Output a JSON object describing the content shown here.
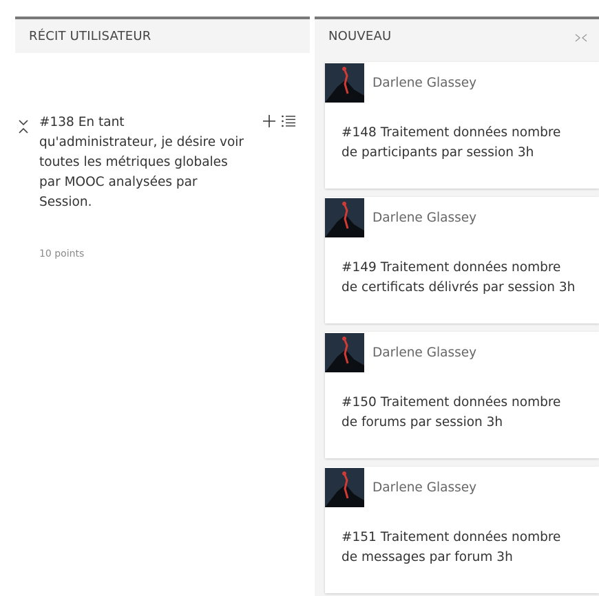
{
  "story_column": {
    "header": "RÉCIT UTILISATEUR",
    "story": {
      "title": "#138 En tant qu'administrateur, je désire voir toutes les métriques globales par MOOC analysées par Session.",
      "points": "10 points",
      "icons": {
        "collapse": "chevron-collapse-icon",
        "add": "plus-icon",
        "list": "list-icon"
      }
    }
  },
  "state_column": {
    "header": "NOUVEAU",
    "collapse_icon": "collapse-column-icon",
    "cards": [
      {
        "assignee": "Darlene Glassey",
        "title": "#148 Traitement données nombre de participants par session 3h"
      },
      {
        "assignee": "Darlene Glassey",
        "title": "#149 Traitement données nombre de certificats délivrés par session 3h"
      },
      {
        "assignee": "Darlene Glassey",
        "title": "#150 Traitement données nombre de forums par session 3h"
      },
      {
        "assignee": "Darlene Glassey",
        "title": "#151 Traitement données nombre de messages par forum 3h"
      }
    ]
  },
  "colors": {
    "header_border": "#797979",
    "column_bg": "#f4f4f4",
    "card_bg": "#ffffff",
    "text": "#333333",
    "muted_text": "#8a8a8a"
  }
}
